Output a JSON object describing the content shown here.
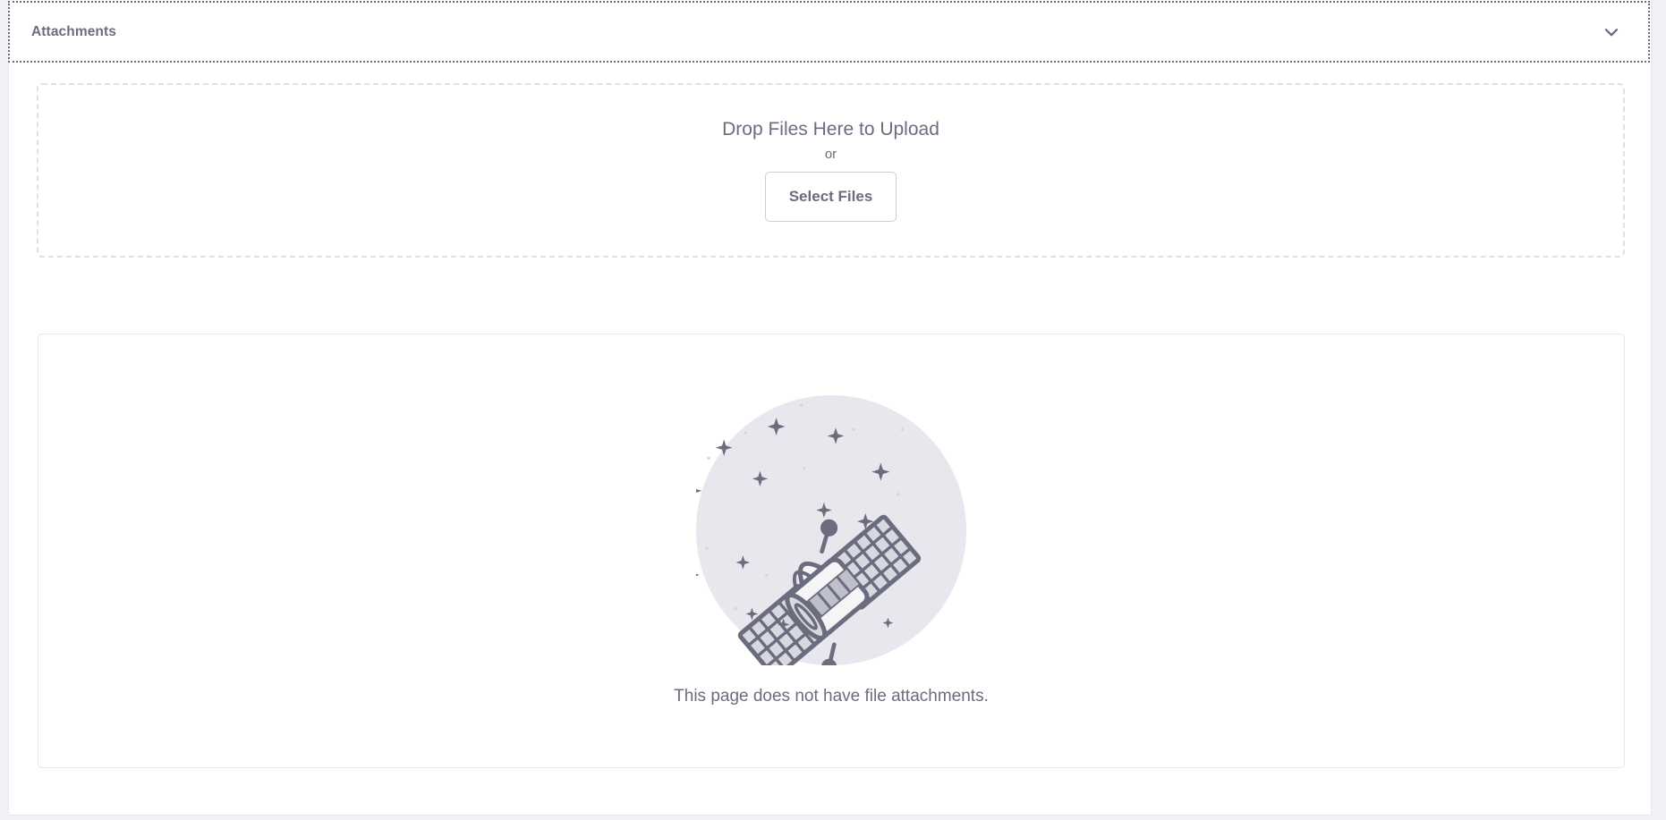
{
  "panel": {
    "title": "Attachments",
    "collapse_icon": "chevron-down-icon",
    "expanded": true
  },
  "dropzone": {
    "title": "Drop Files Here to Upload",
    "separator": "or",
    "button_label": "Select Files"
  },
  "empty_state": {
    "illustration": "satellite-in-space-icon",
    "message": "This page does not have file attachments."
  },
  "colors": {
    "page_background": "#f1f2f5",
    "panel_background": "#ffffff",
    "panel_border": "#e7e7ed",
    "text_primary": "#6b6c7e",
    "dashed_border": "#dfe0e5",
    "button_border": "#cdced9",
    "focus_outline": "#6b6c7e",
    "illustration_circle": "#e7e7ed",
    "illustration_stroke": "#6b6c7e",
    "illustration_fill_light": "#f5f5f7",
    "illustration_fill_mid": "#d8d9e0"
  }
}
